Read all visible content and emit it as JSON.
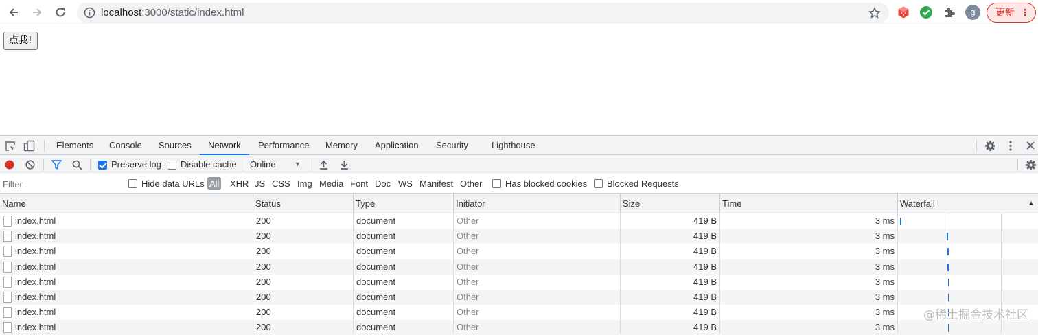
{
  "browser": {
    "url_host": "localhost",
    "url_rest": ":3000/static/index.html",
    "avatar_letter": "g",
    "update_label": "更新",
    "update_menu": "⋮"
  },
  "page": {
    "button_label": "点我!"
  },
  "devtools": {
    "tabs": [
      "Elements",
      "Console",
      "Sources",
      "Network",
      "Performance",
      "Memory",
      "Application",
      "Security",
      "Lighthouse"
    ],
    "active_tab": "Network",
    "network": {
      "preserve_log": "Preserve log",
      "disable_cache": "Disable cache",
      "throttle": "Online",
      "throttle_arrow": "▼"
    },
    "filter": {
      "placeholder": "Filter",
      "hide_data_urls": "Hide data URLs",
      "types": [
        "All",
        "XHR",
        "JS",
        "CSS",
        "Img",
        "Media",
        "Font",
        "Doc",
        "WS",
        "Manifest",
        "Other"
      ],
      "has_blocked_cookies": "Has blocked cookies",
      "blocked_requests": "Blocked Requests"
    },
    "columns": [
      "Name",
      "Status",
      "Type",
      "Initiator",
      "Size",
      "Time",
      "Waterfall"
    ],
    "sort_arrow": "▲",
    "rows": [
      {
        "name": "index.html",
        "status": "200",
        "type": "document",
        "initiator": "Other",
        "size": "419 B",
        "time": "3 ms"
      },
      {
        "name": "index.html",
        "status": "200",
        "type": "document",
        "initiator": "Other",
        "size": "419 B",
        "time": "3 ms"
      },
      {
        "name": "index.html",
        "status": "200",
        "type": "document",
        "initiator": "Other",
        "size": "419 B",
        "time": "3 ms"
      },
      {
        "name": "index.html",
        "status": "200",
        "type": "document",
        "initiator": "Other",
        "size": "419 B",
        "time": "3 ms"
      },
      {
        "name": "index.html",
        "status": "200",
        "type": "document",
        "initiator": "Other",
        "size": "419 B",
        "time": "3 ms"
      },
      {
        "name": "index.html",
        "status": "200",
        "type": "document",
        "initiator": "Other",
        "size": "419 B",
        "time": "3 ms"
      },
      {
        "name": "index.html",
        "status": "200",
        "type": "document",
        "initiator": "Other",
        "size": "419 B",
        "time": "3 ms"
      },
      {
        "name": "index.html",
        "status": "200",
        "type": "document",
        "initiator": "Other",
        "size": "419 B",
        "time": "3 ms"
      }
    ]
  },
  "watermark": "@稀土掘金技术社区"
}
